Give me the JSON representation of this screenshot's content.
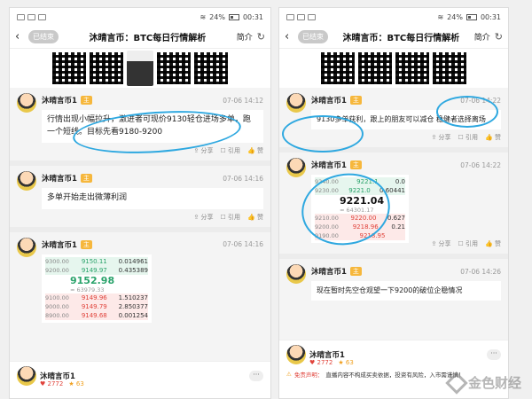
{
  "left": {
    "status": {
      "battery": "24%",
      "time": "00:31"
    },
    "header": {
      "back": "‹",
      "ended": "已结束",
      "title": "沐晴言币：BTC每日行情解析",
      "intro": "简介",
      "share_icon": "↻"
    },
    "messages": [
      {
        "author": "沐晴言币1",
        "role": "主",
        "time": "07-06 14:12",
        "text": "行情出现小幅拉升，激进者可现价9130轻仓进场多单，跑一个短线。目标先看9180-9200"
      },
      {
        "author": "沐晴言币1",
        "role": "主",
        "time": "07-06 14:16",
        "text": "多单开始走出微薄利润"
      },
      {
        "author": "沐晴言币1",
        "role": "主",
        "time": "07-06 14:16"
      }
    ],
    "orderbook": {
      "rows_top": [
        {
          "axis": "9300.00",
          "price": "9150.11",
          "vol": "0.014961"
        },
        {
          "axis": "9200.00",
          "price": "9149.97",
          "vol": "0.435389"
        }
      ],
      "last": "9152.98",
      "last_sub": "≈ 63979.33",
      "rows_bottom": [
        {
          "axis": "9100.00",
          "price": "9149.96",
          "vol": "1.510237"
        },
        {
          "axis": "9000.00",
          "price": "9149.79",
          "vol": "2.850377"
        },
        {
          "axis": "8900.00",
          "price": "9149.68",
          "vol": "0.001254"
        }
      ]
    },
    "actions": {
      "share": "分享",
      "quote": "引用",
      "like": "赞"
    },
    "footer": {
      "author": "沐晴言币1",
      "likes": "2772",
      "favs": "63",
      "more": "···"
    }
  },
  "right": {
    "status": {
      "battery": "24%",
      "time": "00:31"
    },
    "header": {
      "back": "‹",
      "ended": "已结束",
      "title": "沐晴言币：BTC每日行情解析",
      "intro": "简介",
      "share_icon": "↻"
    },
    "messages": [
      {
        "author": "沐晴言币1",
        "role": "主",
        "time": "07-06 14:22",
        "text": "9130多单获利，跟上的朋友可以减仓 稳健者选择离场"
      },
      {
        "author": "沐晴言币1",
        "role": "主",
        "time": "07-06 14:22"
      },
      {
        "author": "沐晴言币1",
        "role": "主",
        "time": "07-06 14:26",
        "text": "现在暂时先空仓观望一下9200的破位企稳情况"
      }
    ],
    "orderbook": {
      "rows_top": [
        {
          "axis": "9240.00",
          "price": "9221.1",
          "vol": "0.0"
        },
        {
          "axis": "9230.00",
          "price": "9221.0",
          "vol": "0.60441"
        }
      ],
      "last": "9221.04",
      "last_sub": "≈ 64301.17",
      "rows_bottom": [
        {
          "axis": "9210.00",
          "price": "9220.00",
          "vol": "0.627"
        },
        {
          "axis": "9200.00",
          "price": "9218.96",
          "vol": "0.21"
        },
        {
          "axis": "9190.00",
          "price": "9218.95",
          "vol": ""
        }
      ]
    },
    "actions": {
      "share": "分享",
      "quote": "引用",
      "like": "赞"
    },
    "footer": {
      "author": "沐晴言币1",
      "likes": "2772",
      "favs": "63",
      "more": "···",
      "disclaimer_label": "免责声明：",
      "disclaimer": "直播内容不构成买卖依据，投资有风险，入市需谨慎！"
    }
  },
  "watermark": "金色财经",
  "colors": {
    "highlight_circle": "#2ea8e0",
    "host_badge": "#f6b73c",
    "up": "#2aa36b",
    "down": "#e0433b"
  }
}
